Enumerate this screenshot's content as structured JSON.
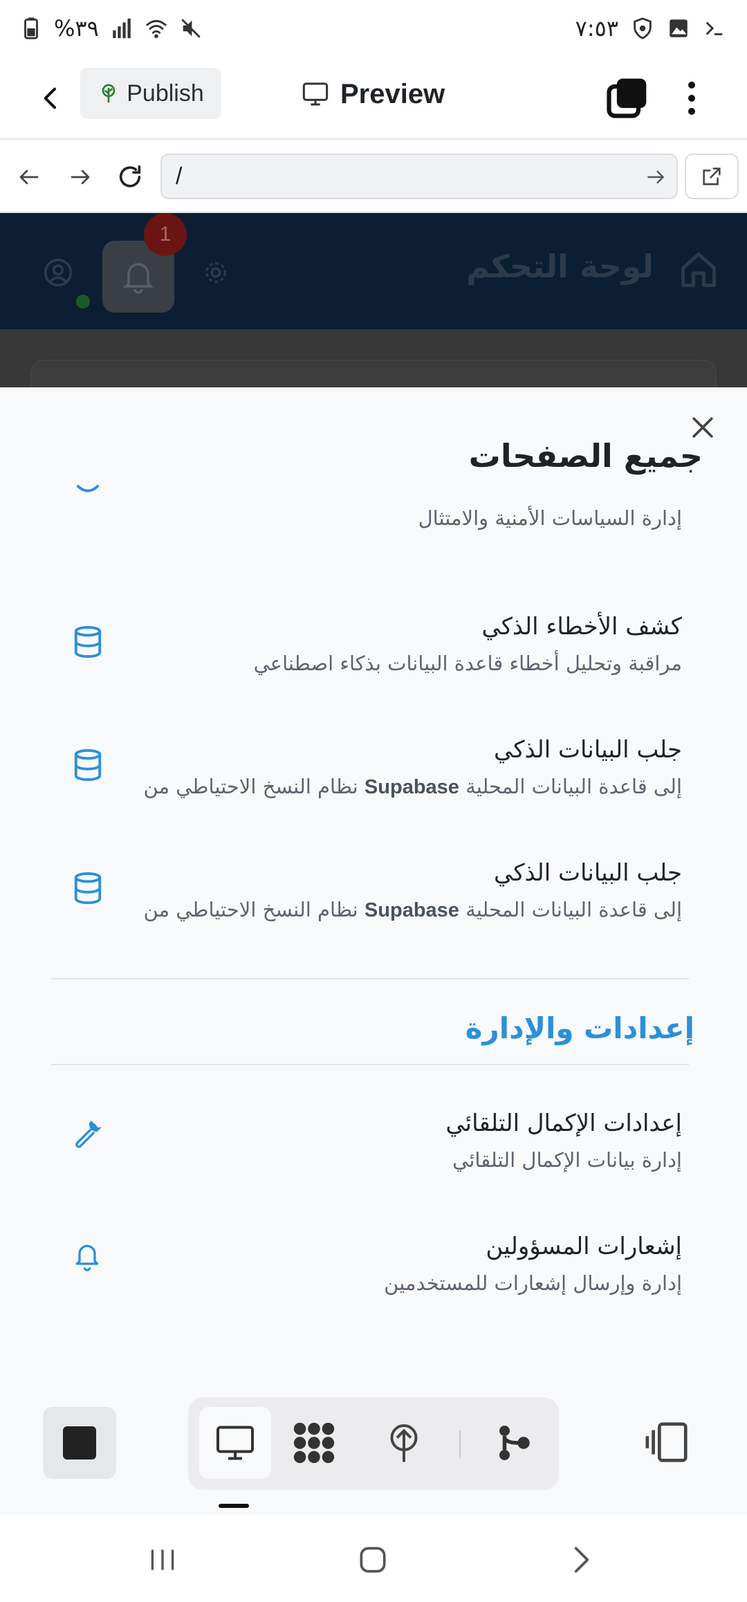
{
  "status_bar": {
    "battery": "%٣٩",
    "time": "٧:٥٣"
  },
  "appbar": {
    "publish_label": "Publish",
    "preview_label": "Preview"
  },
  "browser": {
    "url": "/"
  },
  "background_page": {
    "title": "لوحة التحكم",
    "notification_count": "1"
  },
  "sheet": {
    "title": "جميع الصفحات",
    "items": [
      {
        "title": "",
        "subtitle": "إدارة السياسات الأمنية والامتثال",
        "icon": "shield-icon"
      },
      {
        "title": "كشف الأخطاء الذكي",
        "subtitle": "مراقبة وتحليل أخطاء قاعدة البيانات بذكاء اصطناعي",
        "icon": "database-icon"
      },
      {
        "title": "جلب البيانات الذكي",
        "subtitle_pre": "إلى قاعدة البيانات المحلية",
        "subtitle_bold": "Supabase",
        "subtitle_post": "نظام النسخ الاحتياطي من",
        "icon": "database-icon"
      },
      {
        "title": "جلب البيانات الذكي",
        "subtitle_pre": "إلى قاعدة البيانات المحلية",
        "subtitle_bold": "Supabase",
        "subtitle_post": "نظام النسخ الاحتياطي من",
        "icon": "database-icon"
      }
    ],
    "section_title": "إعدادات والإدارة",
    "section_items": [
      {
        "title": "إعدادات الإكمال التلقائي",
        "subtitle": "إدارة بيانات الإكمال التلقائي",
        "icon": "wrench-icon"
      },
      {
        "title": "إشعارات المسؤولين",
        "subtitle": "إدارة وإرسال إشعارات للمستخدمين",
        "icon": "bell-icon"
      }
    ]
  },
  "colors": {
    "accent": "#2b90d9",
    "dark_header": "#0b1e33"
  }
}
